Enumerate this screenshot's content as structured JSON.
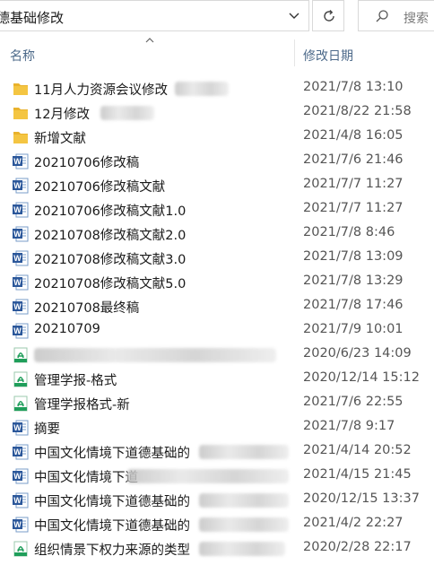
{
  "address": {
    "path": "德基础修改"
  },
  "search": {
    "placeholder": "搜索"
  },
  "columns": {
    "name": "名称",
    "date": "修改日期"
  },
  "files": [
    {
      "type": "folder",
      "name": "11月人力资源会议修改",
      "date": "2021/7/8 13:10"
    },
    {
      "type": "folder",
      "name": "12月修改",
      "date": "2021/8/22 21:58"
    },
    {
      "type": "folder",
      "name": "新增文献",
      "date": "2021/4/8 16:05"
    },
    {
      "type": "word",
      "name": "20210706修改稿",
      "date": "2021/7/6 21:46"
    },
    {
      "type": "word",
      "name": "20210706修改稿文献",
      "date": "2021/7/7 11:27"
    },
    {
      "type": "word",
      "name": "20210706修改稿文献1.0",
      "date": "2021/7/7 11:27"
    },
    {
      "type": "word",
      "name": "20210708修改稿文献2.0",
      "date": "2021/7/8 8:46"
    },
    {
      "type": "word",
      "name": "20210708修改稿文献3.0",
      "date": "2021/7/8 13:09"
    },
    {
      "type": "word",
      "name": "20210708修改稿文献5.0",
      "date": "2021/7/8 13:29"
    },
    {
      "type": "word",
      "name": "20210708最终稿",
      "date": "2021/7/8 17:46"
    },
    {
      "type": "word",
      "name": "20210709",
      "date": "2021/7/9 10:01"
    },
    {
      "type": "pdf",
      "name": "",
      "date": "2020/6/23 14:09"
    },
    {
      "type": "pdf",
      "name": "管理学报-格式",
      "date": "2020/12/14 15:12"
    },
    {
      "type": "pdf",
      "name": "管理学报格式-新",
      "date": "2021/7/6 22:55"
    },
    {
      "type": "word",
      "name": "摘要",
      "date": "2021/7/8 9:17"
    },
    {
      "type": "word",
      "name": "中国文化情境下道德基础的",
      "date": "2021/4/14 20:52"
    },
    {
      "type": "word",
      "name": "中国文化情境下道",
      "date": "2021/4/15 21:45"
    },
    {
      "type": "word",
      "name": "中国文化情境下道德基础的",
      "date": "2020/12/15 13:37"
    },
    {
      "type": "word",
      "name": "中国文化情境下道德基础的",
      "date": "2021/4/2 22:27"
    },
    {
      "type": "pdf",
      "name": "组织情景下权力来源的类型",
      "date": "2020/2/28 22:17"
    }
  ],
  "icons": {
    "folder": "folder-icon",
    "word": "word-document-icon",
    "pdf": "pdf-document-icon"
  },
  "colors": {
    "folder": "#f4c542",
    "word": "#2b579a",
    "pdf": "#1f9e5a"
  }
}
